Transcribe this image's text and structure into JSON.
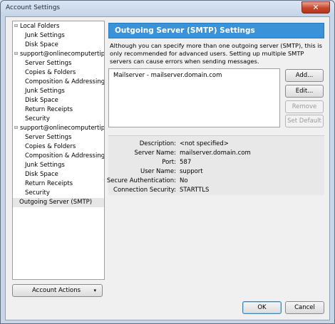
{
  "window": {
    "title": "Account Settings",
    "close": "✕"
  },
  "tree": [
    {
      "label": "Local Folders",
      "level": 0,
      "toggle": "⊟"
    },
    {
      "label": "Junk Settings",
      "level": 1
    },
    {
      "label": "Disk Space",
      "level": 1
    },
    {
      "label": "support@onlinecomputertip...",
      "level": 0,
      "toggle": "⊟"
    },
    {
      "label": "Server Settings",
      "level": 1
    },
    {
      "label": "Copies & Folders",
      "level": 1
    },
    {
      "label": "Composition & Addressing",
      "level": 1
    },
    {
      "label": "Junk Settings",
      "level": 1
    },
    {
      "label": "Disk Space",
      "level": 1
    },
    {
      "label": "Return Receipts",
      "level": 1
    },
    {
      "label": "Security",
      "level": 1
    },
    {
      "label": "support@onlinecomputertip...",
      "level": 0,
      "toggle": "⊟"
    },
    {
      "label": "Server Settings",
      "level": 1
    },
    {
      "label": "Copies & Folders",
      "level": 1
    },
    {
      "label": "Composition & Addressing",
      "level": 1
    },
    {
      "label": "Junk Settings",
      "level": 1
    },
    {
      "label": "Disk Space",
      "level": 1
    },
    {
      "label": "Return Receipts",
      "level": 1
    },
    {
      "label": "Security",
      "level": 1
    },
    {
      "label": "Outgoing Server (SMTP)",
      "level": 0,
      "selected": true
    }
  ],
  "account_actions": {
    "label": "Account Actions",
    "arrow": "▾"
  },
  "panel": {
    "heading": "Outgoing Server (SMTP) Settings",
    "description": "Although you can specify more than one outgoing server (SMTP), this is only recommended for advanced users. Setting up multiple SMTP servers can cause errors when sending messages.",
    "servers": [
      "Mailserver - mailserver.domain.com"
    ],
    "buttons": {
      "add": "Add...",
      "edit": "Edit...",
      "remove": "Remove",
      "set_default": "Set Default"
    }
  },
  "details": [
    {
      "key": "Description:",
      "value": "<not specified>"
    },
    {
      "key": "Server Name:",
      "value": "mailserver.domain.com"
    },
    {
      "key": "Port:",
      "value": "587"
    },
    {
      "key": "User Name:",
      "value": "support"
    },
    {
      "key": "Secure Authentication:",
      "value": "No"
    },
    {
      "key": "Connection Security:",
      "value": "STARTTLS"
    }
  ],
  "footer": {
    "ok": "OK",
    "cancel": "Cancel"
  }
}
